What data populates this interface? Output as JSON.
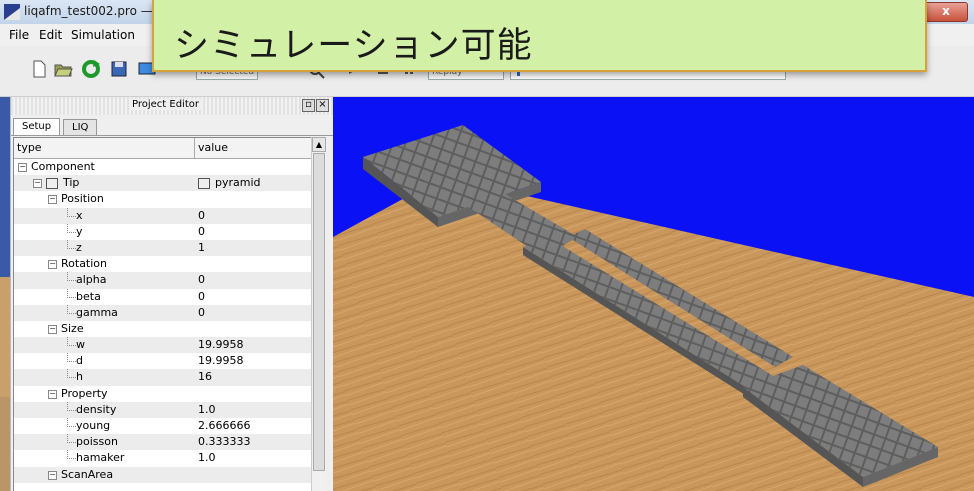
{
  "window": {
    "title": "liqafm_test002.pro — L",
    "close_label": "x"
  },
  "menu": {
    "items": [
      "File",
      "Edit",
      "Simulation"
    ]
  },
  "toolbar": {
    "combo_value": "No Selected",
    "replay_value": "Replay"
  },
  "callout": {
    "text": "シミュレーション可能"
  },
  "panel": {
    "title": "Project Editor",
    "tabs": [
      "Setup",
      "LIQ"
    ],
    "columns": {
      "type": "type",
      "value": "value"
    },
    "rows": [
      {
        "label": "Component",
        "value": "",
        "depth": 0,
        "expander": "−"
      },
      {
        "label": "Tip",
        "value": "pyramid",
        "depth": 1,
        "expander": "−",
        "icon": "grid-icon"
      },
      {
        "label": "Position",
        "value": "",
        "depth": 2,
        "expander": "−"
      },
      {
        "label": "x",
        "value": "0",
        "depth": 3
      },
      {
        "label": "y",
        "value": "0",
        "depth": 3
      },
      {
        "label": "z",
        "value": "1",
        "depth": 3
      },
      {
        "label": "Rotation",
        "value": "",
        "depth": 2,
        "expander": "−"
      },
      {
        "label": "alpha",
        "value": "0",
        "depth": 3
      },
      {
        "label": "beta",
        "value": "0",
        "depth": 3
      },
      {
        "label": "gamma",
        "value": "0",
        "depth": 3
      },
      {
        "label": "Size",
        "value": "",
        "depth": 2,
        "expander": "−"
      },
      {
        "label": "w",
        "value": "19.9958",
        "depth": 3
      },
      {
        "label": "d",
        "value": "19.9958",
        "depth": 3
      },
      {
        "label": "h",
        "value": "16",
        "depth": 3
      },
      {
        "label": "Property",
        "value": "",
        "depth": 2,
        "expander": "−"
      },
      {
        "label": "density",
        "value": "1.0",
        "depth": 3
      },
      {
        "label": "young",
        "value": "2.666666",
        "depth": 3
      },
      {
        "label": "poisson",
        "value": "0.333333",
        "depth": 3
      },
      {
        "label": "hamaker",
        "value": "1.0",
        "depth": 3
      },
      {
        "label": "ScanArea",
        "value": "",
        "depth": 2,
        "expander": "−"
      }
    ]
  },
  "colors": {
    "viewport_bg": "#0a12f5",
    "floor": "#c9975c",
    "block": "#7a7a7a",
    "callout_bg": "#d2f0a6",
    "callout_border": "#d6a23a"
  }
}
